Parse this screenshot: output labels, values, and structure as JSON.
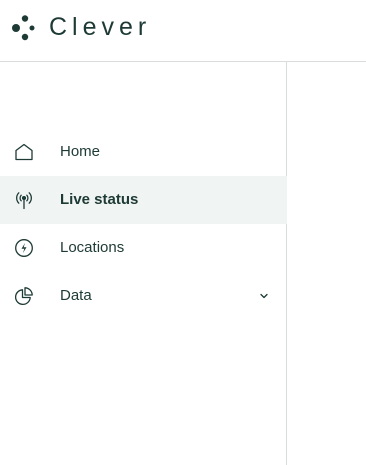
{
  "brand": {
    "name": "Clever",
    "color": "#1e3a35"
  },
  "sidebar": {
    "items": [
      {
        "label": "Home",
        "icon": "home-icon",
        "active": false
      },
      {
        "label": "Live status",
        "icon": "antenna-icon",
        "active": true
      },
      {
        "label": "Locations",
        "icon": "lightning-icon",
        "active": false
      },
      {
        "label": "Data",
        "icon": "pie-chart-icon",
        "active": false,
        "expandable": true
      }
    ]
  },
  "colors": {
    "active_background": "#f0f4f3",
    "border": "#d9dedd",
    "text": "#1e3a35"
  }
}
